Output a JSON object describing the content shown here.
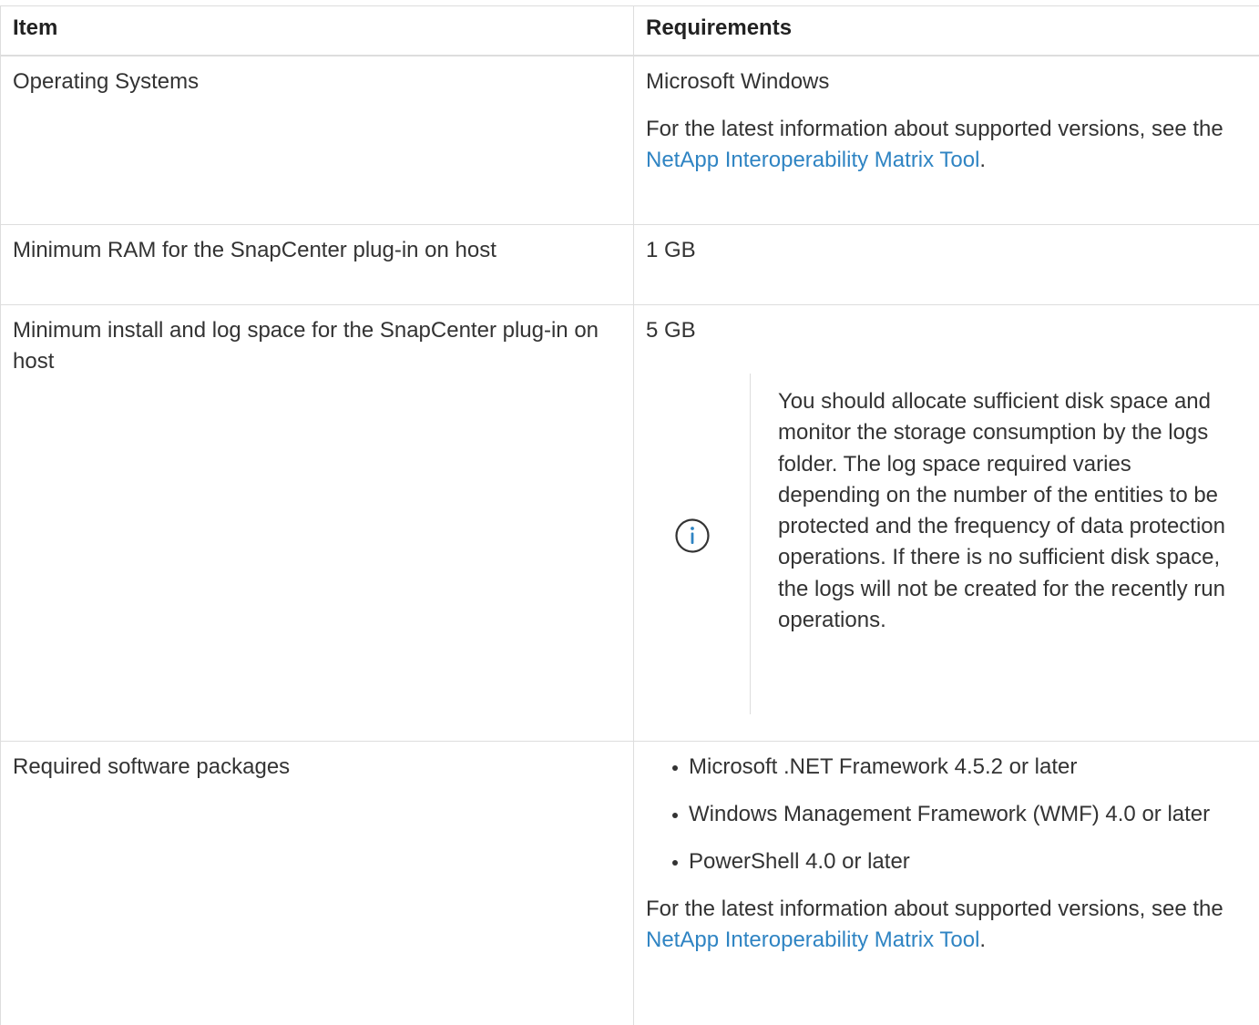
{
  "table": {
    "headers": {
      "item": "Item",
      "requirements": "Requirements"
    },
    "rows": [
      {
        "item": "Operating Systems",
        "requirement_main": "Microsoft Windows",
        "info_prefix": "For the latest information about supported versions, see the ",
        "info_link": "NetApp Interoperability Matrix Tool",
        "info_suffix": "."
      },
      {
        "item": "Minimum RAM for the SnapCenter plug-in on host",
        "requirement_main": "1 GB"
      },
      {
        "item": "Minimum install and log space for the SnapCenter plug-in on host",
        "requirement_main": "5 GB",
        "note_icon": "info-icon",
        "note_text": "You should allocate sufficient disk space and monitor the storage consumption by the logs folder. The log space required varies depending on the number of the entities to be protected and the frequency of data protection operations. If there is no sufficient disk space, the logs will not be created for the recently run operations."
      },
      {
        "item": "Required software packages",
        "packages": [
          "Microsoft .NET Framework 4.5.2 or later",
          "Windows Management Framework (WMF) 4.0 or later",
          "PowerShell 4.0 or later"
        ],
        "info_prefix": "For the latest information about supported versions, see the ",
        "info_link": "NetApp Interoperability Matrix Tool",
        "info_suffix": "."
      }
    ]
  },
  "colors": {
    "link": "#2f84c3",
    "icon": "#2f84c3",
    "text": "#333333",
    "border": "#dddddd"
  }
}
